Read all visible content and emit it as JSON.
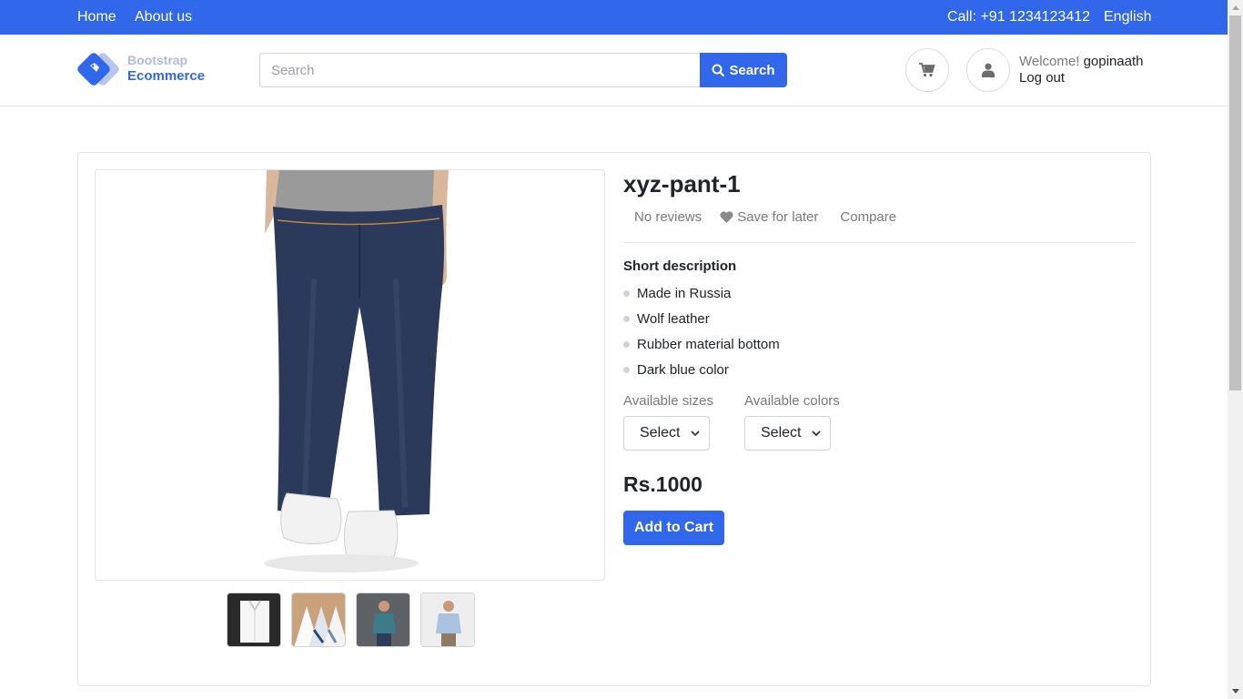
{
  "topbar": {
    "home": "Home",
    "about": "About us",
    "call": "Call: +91 1234123412",
    "language": "English"
  },
  "header": {
    "logo_line1": "Bootstrap",
    "logo_line2": "Ecommerce",
    "search_placeholder": "Search",
    "search_button": "Search",
    "welcome_prefix": "Welcome!",
    "username": "gopinaath",
    "logout": "Log out"
  },
  "product": {
    "title": "xyz-pant-1",
    "reviews": "No reviews",
    "save_for_later": "Save for later",
    "compare": "Compare",
    "short_description_title": "Short description",
    "features": [
      "Made in Russia",
      "Wolf leather",
      "Rubber material bottom",
      "Dark blue color"
    ],
    "sizes_label": "Available sizes",
    "sizes_value": "Select",
    "colors_label": "Available colors",
    "colors_value": "Select",
    "price": "Rs.1000",
    "add_to_cart": "Add to Cart"
  },
  "colors": {
    "brand": "#3167eb",
    "muted": "#7a7a7a"
  }
}
